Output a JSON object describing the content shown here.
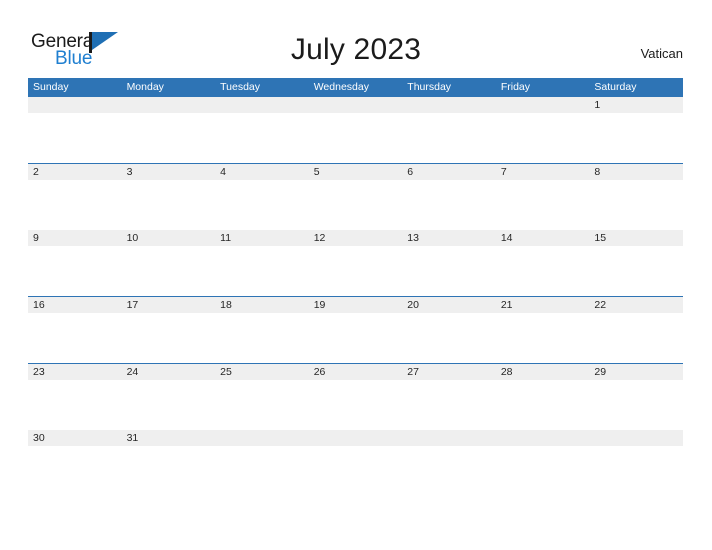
{
  "brand": {
    "word_one": "General",
    "word_two": "Blue",
    "flag_icon": "flag-triangle-icon",
    "color_dark": "#1b1b1b",
    "color_blue": "#1f7fd0",
    "flag_color": "#1f6fb4"
  },
  "header": {
    "title": "July 2023",
    "region": "Vatican"
  },
  "theme": {
    "header_blue": "#2e74b5",
    "band_gray": "#efefef",
    "text_dark": "#262626",
    "page_background": "#ffffff"
  },
  "calendar": {
    "month": "July",
    "year": "2023",
    "weekday_headers": [
      "Sunday",
      "Monday",
      "Tuesday",
      "Wednesday",
      "Thursday",
      "Friday",
      "Saturday"
    ],
    "weeks": [
      [
        "",
        "",
        "",
        "",
        "",
        "",
        "1"
      ],
      [
        "2",
        "3",
        "4",
        "5",
        "6",
        "7",
        "8"
      ],
      [
        "9",
        "10",
        "11",
        "12",
        "13",
        "14",
        "15"
      ],
      [
        "16",
        "17",
        "18",
        "19",
        "20",
        "21",
        "22"
      ],
      [
        "23",
        "24",
        "25",
        "26",
        "27",
        "28",
        "29"
      ],
      [
        "30",
        "31",
        "",
        "",
        "",
        "",
        ""
      ]
    ]
  }
}
